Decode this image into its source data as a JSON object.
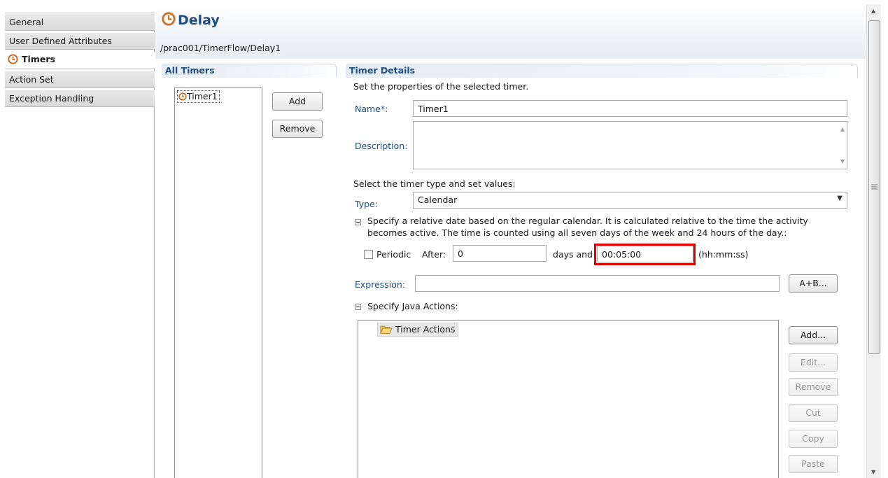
{
  "sidebar": {
    "items": [
      {
        "label": "General"
      },
      {
        "label": "User Defined Attributes"
      },
      {
        "label": "Timers",
        "icon": "clock-icon",
        "selected": true
      },
      {
        "label": "Action Set"
      },
      {
        "label": "Exception Handling"
      }
    ]
  },
  "header": {
    "title": "Delay",
    "title_icon": "clock-icon",
    "breadcrumb": "/prac001/TimerFlow/Delay1"
  },
  "all_timers": {
    "heading": "All Timers",
    "items": [
      {
        "label": "Timer1",
        "icon": "clock-icon"
      }
    ],
    "add_label": "Add",
    "remove_label": "Remove"
  },
  "timer_details": {
    "heading": "Timer Details",
    "intro": "Set the properties of the selected timer.",
    "name_label": "Name*:",
    "name_value": "Timer1",
    "description_label": "Description:",
    "description_value": "",
    "type_prompt": "Select the timer type and set values:",
    "type_label": "Type:",
    "type_value": "Calendar",
    "calendar_note_line1": "Specify a relative date based on the regular calendar. It is calculated relative to the time the activity",
    "calendar_note_line2": "becomes active. The time is counted using all seven days of the week and 24 hours of the day.:",
    "periodic_label": "Periodic",
    "periodic_checked": false,
    "after_label": "After:",
    "days_value": "0",
    "days_and_label": "days and",
    "time_value": "00:05:00",
    "time_format_label": "(hh:mm:ss)",
    "expression_label": "Expression:",
    "expression_value": "",
    "expression_button": "A+B...",
    "java_actions_label": "Specify Java Actions:",
    "tree_root": "Timer Actions",
    "tree_root_icon": "folder-open-icon",
    "action_buttons": {
      "add": "Add...",
      "edit": "Edit...",
      "remove": "Remove",
      "cut": "Cut",
      "copy": "Copy",
      "paste": "Paste"
    }
  },
  "colors": {
    "heading_blue": "#1f4f86",
    "highlight_red": "#e00000"
  }
}
